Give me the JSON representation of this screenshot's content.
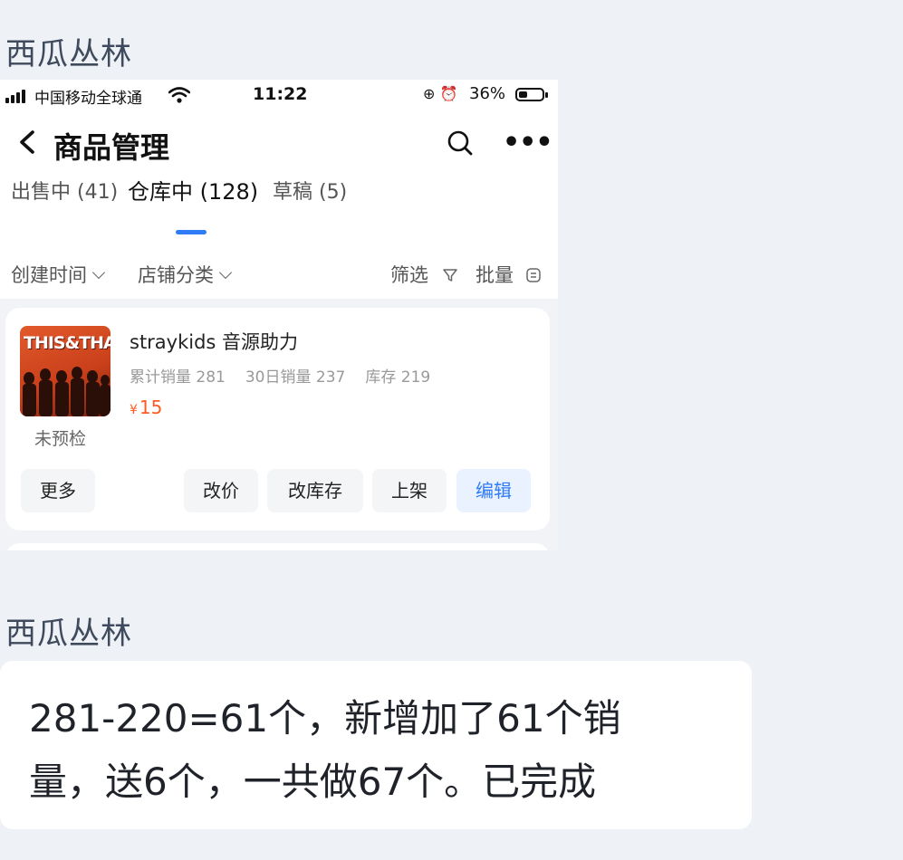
{
  "messages": [
    {
      "sender": "西瓜丛林",
      "type": "image"
    },
    {
      "sender": "西瓜丛林",
      "type": "text",
      "lines": [
        "281-220=61个，新增加了61个销",
        "量，送6个，一共做67个。已完成"
      ]
    }
  ],
  "screenshot": {
    "status_bar": {
      "carrier": "中国移动全球通",
      "time": "11:22",
      "battery": "36%",
      "battery_level_pct": 36
    },
    "nav": {
      "title": "商品管理"
    },
    "tabs": [
      {
        "label": "出售中 (41)",
        "active": false
      },
      {
        "label": "仓库中 (128)",
        "active": true
      },
      {
        "label": "草稿 (5)",
        "active": false
      }
    ],
    "filters": {
      "created_time": "创建时间",
      "shop_category": "店铺分类",
      "filter": "筛选",
      "batch": "批量"
    },
    "product": {
      "name": "straykids 音源助力",
      "cover_text": "THIS&THAT",
      "inspection_tag": "未预检",
      "cumulative_sales": "累计销量 281",
      "sales_30d": "30日销量 237",
      "stock": "库存 219",
      "currency": "¥",
      "price": "15",
      "actions": {
        "more": "更多",
        "change_price": "改价",
        "change_stock": "改库存",
        "list": "上架",
        "edit": "编辑"
      }
    }
  },
  "colors": {
    "accent": "#2f7cf6",
    "price": "#ff5a1f",
    "background": "#eef1f6"
  }
}
